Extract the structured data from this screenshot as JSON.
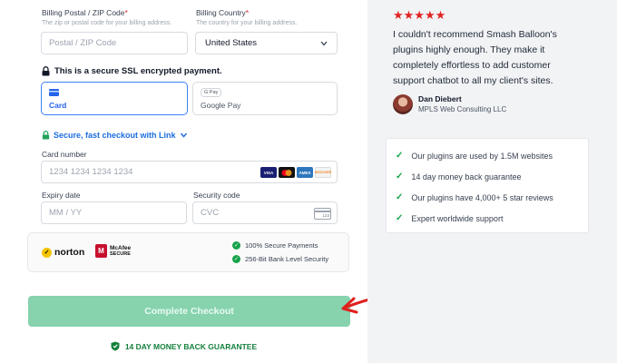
{
  "billing": {
    "postal_label": "Billing Postal / ZIP Code",
    "postal_required": "*",
    "postal_hint": "The zip or postal code for your billing address.",
    "postal_placeholder": "Postal / ZIP Code",
    "country_label": "Billing Country",
    "country_required": "*",
    "country_hint": "The country for your billing address.",
    "country_value": "United States"
  },
  "ssl_notice": "This is a secure SSL encrypted payment.",
  "payment_methods": {
    "card_label": "Card",
    "gpay_badge": "G Pay",
    "gpay_label": "Google Pay"
  },
  "link_checkout": "Secure, fast checkout with Link",
  "card": {
    "number_label": "Card number",
    "number_placeholder": "1234 1234 1234 1234",
    "brands": [
      {
        "name": "VISA",
        "color": "#1a1f71"
      },
      {
        "name": "MC",
        "color": "#eb001b"
      },
      {
        "name": "AMEX",
        "color": "#2e77bc"
      },
      {
        "name": "DISCOVER",
        "color": "#f4f4f4"
      }
    ],
    "expiry_label": "Expiry date",
    "expiry_placeholder": "MM / YY",
    "cvc_label": "Security code",
    "cvc_placeholder": "CVC",
    "cvc_icon_text": "123"
  },
  "trust": {
    "norton": "norton",
    "mcafee_1": "McAfee",
    "mcafee_2": "SECURE",
    "line1": "100% Secure Payments",
    "line2": "256-Bit Bank Level Security"
  },
  "checkout_button": "Complete Checkout",
  "guarantee": "14 DAY MONEY BACK GUARANTEE",
  "testimonial": {
    "stars": "★★★★★",
    "quote": "I couldn't recommend Smash Balloon's plugins highly enough. They make it completely effortless to add customer support chatbot to all my client's sites.",
    "name": "Dan Diebert",
    "company": "MPLS Web Consulting LLC"
  },
  "features": [
    "Our plugins are used by 1.5M websites",
    "14 day money back guarantee",
    "Our plugins have 4,000+ 5 star reviews",
    "Expert worldwide support"
  ],
  "colors": {
    "accent_blue": "#3b82f6",
    "button_green": "#86d3ae",
    "check_green": "#16a34a",
    "star_red": "#e02424",
    "annotation_arrow": "#e0201d"
  }
}
